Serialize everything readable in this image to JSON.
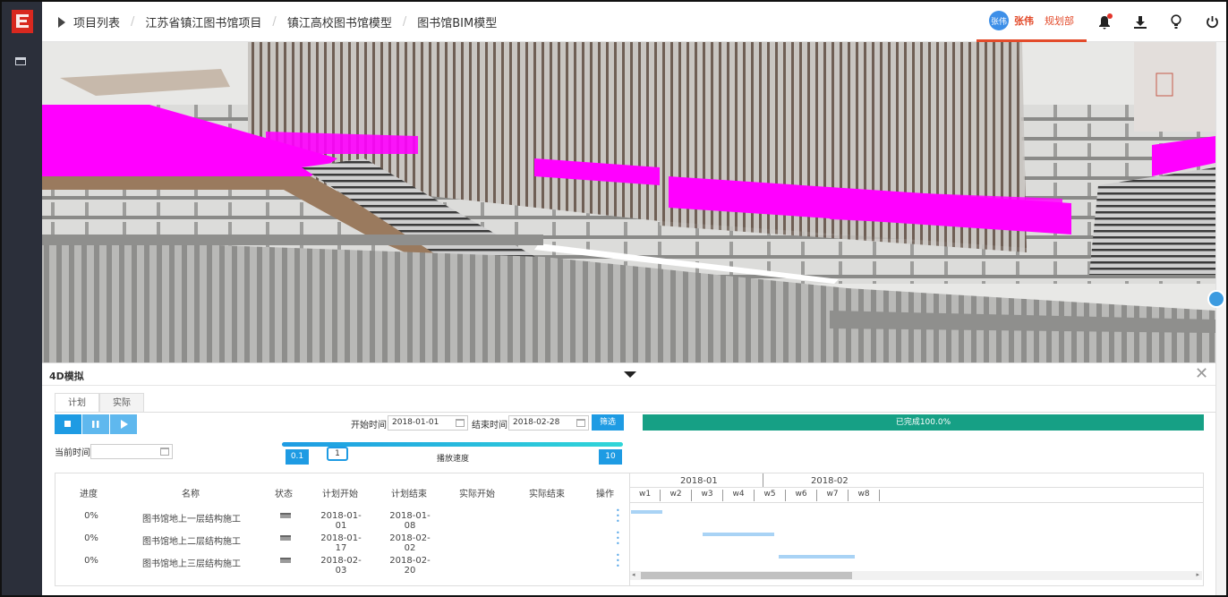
{
  "header": {
    "breadcrumbs": [
      "项目列表",
      "江苏省镇江图书馆项目",
      "镇江高校图书馆模型",
      "图书馆BIM模型"
    ],
    "user": {
      "avatar_text": "张伟",
      "name": "张伟",
      "department": "规划部"
    }
  },
  "panel": {
    "title": "4D模拟",
    "tabs": [
      "计划",
      "实际"
    ],
    "start_label": "开始时间",
    "start_value": "2018-01-01",
    "end_label": "结束时间",
    "end_value": "2018-02-28",
    "filter_label": "筛选",
    "progress_text": "已完成100.0%",
    "progress_percent": 100,
    "current_time_label": "当前时间",
    "current_time_value": "",
    "speed": {
      "min": "0.1",
      "current": "1",
      "max": "10",
      "label": "播放速度",
      "level_fraction": 0.1
    },
    "table": {
      "headers": [
        "进度",
        "名称",
        "状态",
        "计划开始",
        "计划结束",
        "实际开始",
        "实际结束",
        "操作"
      ],
      "rows": [
        {
          "progress": "0%",
          "name": "图书馆地上一层结构施工",
          "plan_start": "2018-01-01",
          "plan_end": "2018-01-08",
          "actual_start": "",
          "actual_end": ""
        },
        {
          "progress": "0%",
          "name": "图书馆地上二层结构施工",
          "plan_start": "2018-01-17",
          "plan_end": "2018-02-02",
          "actual_start": "",
          "actual_end": ""
        },
        {
          "progress": "0%",
          "name": "图书馆地上三层结构施工",
          "plan_start": "2018-02-03",
          "plan_end": "2018-02-20",
          "actual_start": "",
          "actual_end": ""
        }
      ]
    },
    "gantt": {
      "months": [
        "2018-01",
        "2018-02"
      ],
      "weeks": [
        "w1",
        "w2",
        "w3",
        "w4",
        "w5",
        "w6",
        "w7",
        "w8"
      ]
    }
  },
  "colors": {
    "accent": "#1e9be3",
    "progress": "#16a085",
    "user": "#e34b2b",
    "highlight": "#ff00ff"
  }
}
